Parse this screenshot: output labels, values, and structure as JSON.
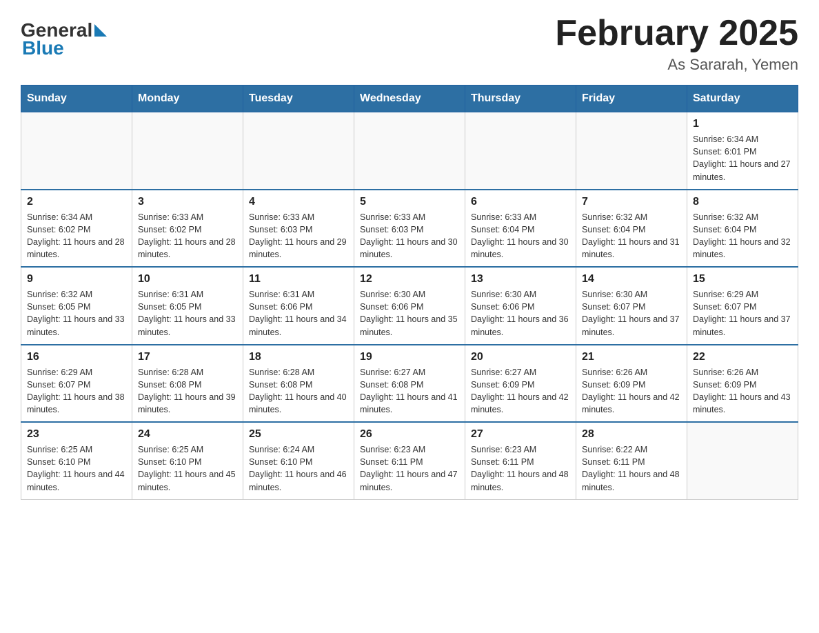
{
  "header": {
    "logo_general": "General",
    "logo_blue": "Blue",
    "month_title": "February 2025",
    "location": "As Sararah, Yemen"
  },
  "days_of_week": [
    "Sunday",
    "Monday",
    "Tuesday",
    "Wednesday",
    "Thursday",
    "Friday",
    "Saturday"
  ],
  "weeks": [
    [
      {
        "day": "",
        "sunrise": "",
        "sunset": "",
        "daylight": ""
      },
      {
        "day": "",
        "sunrise": "",
        "sunset": "",
        "daylight": ""
      },
      {
        "day": "",
        "sunrise": "",
        "sunset": "",
        "daylight": ""
      },
      {
        "day": "",
        "sunrise": "",
        "sunset": "",
        "daylight": ""
      },
      {
        "day": "",
        "sunrise": "",
        "sunset": "",
        "daylight": ""
      },
      {
        "day": "",
        "sunrise": "",
        "sunset": "",
        "daylight": ""
      },
      {
        "day": "1",
        "sunrise": "Sunrise: 6:34 AM",
        "sunset": "Sunset: 6:01 PM",
        "daylight": "Daylight: 11 hours and 27 minutes."
      }
    ],
    [
      {
        "day": "2",
        "sunrise": "Sunrise: 6:34 AM",
        "sunset": "Sunset: 6:02 PM",
        "daylight": "Daylight: 11 hours and 28 minutes."
      },
      {
        "day": "3",
        "sunrise": "Sunrise: 6:33 AM",
        "sunset": "Sunset: 6:02 PM",
        "daylight": "Daylight: 11 hours and 28 minutes."
      },
      {
        "day": "4",
        "sunrise": "Sunrise: 6:33 AM",
        "sunset": "Sunset: 6:03 PM",
        "daylight": "Daylight: 11 hours and 29 minutes."
      },
      {
        "day": "5",
        "sunrise": "Sunrise: 6:33 AM",
        "sunset": "Sunset: 6:03 PM",
        "daylight": "Daylight: 11 hours and 30 minutes."
      },
      {
        "day": "6",
        "sunrise": "Sunrise: 6:33 AM",
        "sunset": "Sunset: 6:04 PM",
        "daylight": "Daylight: 11 hours and 30 minutes."
      },
      {
        "day": "7",
        "sunrise": "Sunrise: 6:32 AM",
        "sunset": "Sunset: 6:04 PM",
        "daylight": "Daylight: 11 hours and 31 minutes."
      },
      {
        "day": "8",
        "sunrise": "Sunrise: 6:32 AM",
        "sunset": "Sunset: 6:04 PM",
        "daylight": "Daylight: 11 hours and 32 minutes."
      }
    ],
    [
      {
        "day": "9",
        "sunrise": "Sunrise: 6:32 AM",
        "sunset": "Sunset: 6:05 PM",
        "daylight": "Daylight: 11 hours and 33 minutes."
      },
      {
        "day": "10",
        "sunrise": "Sunrise: 6:31 AM",
        "sunset": "Sunset: 6:05 PM",
        "daylight": "Daylight: 11 hours and 33 minutes."
      },
      {
        "day": "11",
        "sunrise": "Sunrise: 6:31 AM",
        "sunset": "Sunset: 6:06 PM",
        "daylight": "Daylight: 11 hours and 34 minutes."
      },
      {
        "day": "12",
        "sunrise": "Sunrise: 6:30 AM",
        "sunset": "Sunset: 6:06 PM",
        "daylight": "Daylight: 11 hours and 35 minutes."
      },
      {
        "day": "13",
        "sunrise": "Sunrise: 6:30 AM",
        "sunset": "Sunset: 6:06 PM",
        "daylight": "Daylight: 11 hours and 36 minutes."
      },
      {
        "day": "14",
        "sunrise": "Sunrise: 6:30 AM",
        "sunset": "Sunset: 6:07 PM",
        "daylight": "Daylight: 11 hours and 37 minutes."
      },
      {
        "day": "15",
        "sunrise": "Sunrise: 6:29 AM",
        "sunset": "Sunset: 6:07 PM",
        "daylight": "Daylight: 11 hours and 37 minutes."
      }
    ],
    [
      {
        "day": "16",
        "sunrise": "Sunrise: 6:29 AM",
        "sunset": "Sunset: 6:07 PM",
        "daylight": "Daylight: 11 hours and 38 minutes."
      },
      {
        "day": "17",
        "sunrise": "Sunrise: 6:28 AM",
        "sunset": "Sunset: 6:08 PM",
        "daylight": "Daylight: 11 hours and 39 minutes."
      },
      {
        "day": "18",
        "sunrise": "Sunrise: 6:28 AM",
        "sunset": "Sunset: 6:08 PM",
        "daylight": "Daylight: 11 hours and 40 minutes."
      },
      {
        "day": "19",
        "sunrise": "Sunrise: 6:27 AM",
        "sunset": "Sunset: 6:08 PM",
        "daylight": "Daylight: 11 hours and 41 minutes."
      },
      {
        "day": "20",
        "sunrise": "Sunrise: 6:27 AM",
        "sunset": "Sunset: 6:09 PM",
        "daylight": "Daylight: 11 hours and 42 minutes."
      },
      {
        "day": "21",
        "sunrise": "Sunrise: 6:26 AM",
        "sunset": "Sunset: 6:09 PM",
        "daylight": "Daylight: 11 hours and 42 minutes."
      },
      {
        "day": "22",
        "sunrise": "Sunrise: 6:26 AM",
        "sunset": "Sunset: 6:09 PM",
        "daylight": "Daylight: 11 hours and 43 minutes."
      }
    ],
    [
      {
        "day": "23",
        "sunrise": "Sunrise: 6:25 AM",
        "sunset": "Sunset: 6:10 PM",
        "daylight": "Daylight: 11 hours and 44 minutes."
      },
      {
        "day": "24",
        "sunrise": "Sunrise: 6:25 AM",
        "sunset": "Sunset: 6:10 PM",
        "daylight": "Daylight: 11 hours and 45 minutes."
      },
      {
        "day": "25",
        "sunrise": "Sunrise: 6:24 AM",
        "sunset": "Sunset: 6:10 PM",
        "daylight": "Daylight: 11 hours and 46 minutes."
      },
      {
        "day": "26",
        "sunrise": "Sunrise: 6:23 AM",
        "sunset": "Sunset: 6:11 PM",
        "daylight": "Daylight: 11 hours and 47 minutes."
      },
      {
        "day": "27",
        "sunrise": "Sunrise: 6:23 AM",
        "sunset": "Sunset: 6:11 PM",
        "daylight": "Daylight: 11 hours and 48 minutes."
      },
      {
        "day": "28",
        "sunrise": "Sunrise: 6:22 AM",
        "sunset": "Sunset: 6:11 PM",
        "daylight": "Daylight: 11 hours and 48 minutes."
      },
      {
        "day": "",
        "sunrise": "",
        "sunset": "",
        "daylight": ""
      }
    ]
  ]
}
